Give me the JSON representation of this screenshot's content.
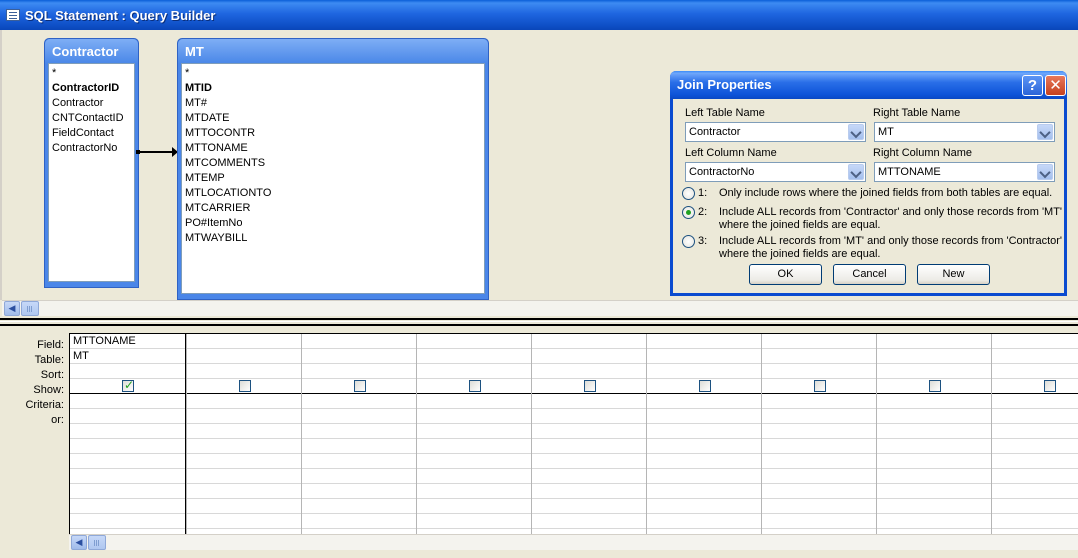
{
  "window": {
    "title": "SQL Statement : Query Builder"
  },
  "tables": [
    {
      "name": "Contractor",
      "fields": [
        "*",
        "ContractorID",
        "Contractor",
        "CNTContactID",
        "FieldContact",
        "ContractorNo"
      ],
      "key_index": 1
    },
    {
      "name": "MT",
      "fields": [
        "*",
        "MTID",
        "MT#",
        "MTDATE",
        "MTTOCONTR",
        "MTTONAME",
        "MTCOMMENTS",
        "MTEMP",
        "MTLOCATIONTO",
        "MTCARRIER",
        "PO#ItemNo",
        "MTWAYBILL"
      ],
      "key_index": 1
    }
  ],
  "grid": {
    "row_labels": [
      "Field:",
      "Table:",
      "Sort:",
      "Show:",
      "Criteria:",
      "or:"
    ],
    "columns": [
      {
        "field": "MTTONAME",
        "table": "MT",
        "show": true
      },
      {
        "field": "",
        "table": "",
        "show": false
      },
      {
        "field": "",
        "table": "",
        "show": false
      },
      {
        "field": "",
        "table": "",
        "show": false
      },
      {
        "field": "",
        "table": "",
        "show": false
      },
      {
        "field": "",
        "table": "",
        "show": false
      },
      {
        "field": "",
        "table": "",
        "show": false
      },
      {
        "field": "",
        "table": "",
        "show": false
      },
      {
        "field": "",
        "table": "",
        "show": false
      }
    ]
  },
  "dialog": {
    "title": "Join Properties",
    "help_label": "?",
    "close_label": "✕",
    "left_table_label": "Left Table Name",
    "right_table_label": "Right Table Name",
    "left_table_value": "Contractor",
    "right_table_value": "MT",
    "left_column_label": "Left Column Name",
    "right_column_label": "Right Column Name",
    "left_column_value": "ContractorNo",
    "right_column_value": "MTTONAME",
    "options": [
      {
        "num": "1:",
        "text": "Only include rows where the joined fields from both tables are equal.",
        "selected": false
      },
      {
        "num": "2:",
        "text": "Include ALL records from 'Contractor' and only those records from 'MT' where the joined fields are equal.",
        "selected": true
      },
      {
        "num": "3:",
        "text": "Include ALL records from 'MT' and only those records from 'Contractor' where the joined fields are equal.",
        "selected": false
      }
    ],
    "ok_label": "OK",
    "cancel_label": "Cancel",
    "new_label": "New"
  },
  "icons": {
    "window_icon": "query-window-icon",
    "scroll_left": "scroll-left-arrow-icon",
    "dropdown": "chevron-down-icon"
  }
}
